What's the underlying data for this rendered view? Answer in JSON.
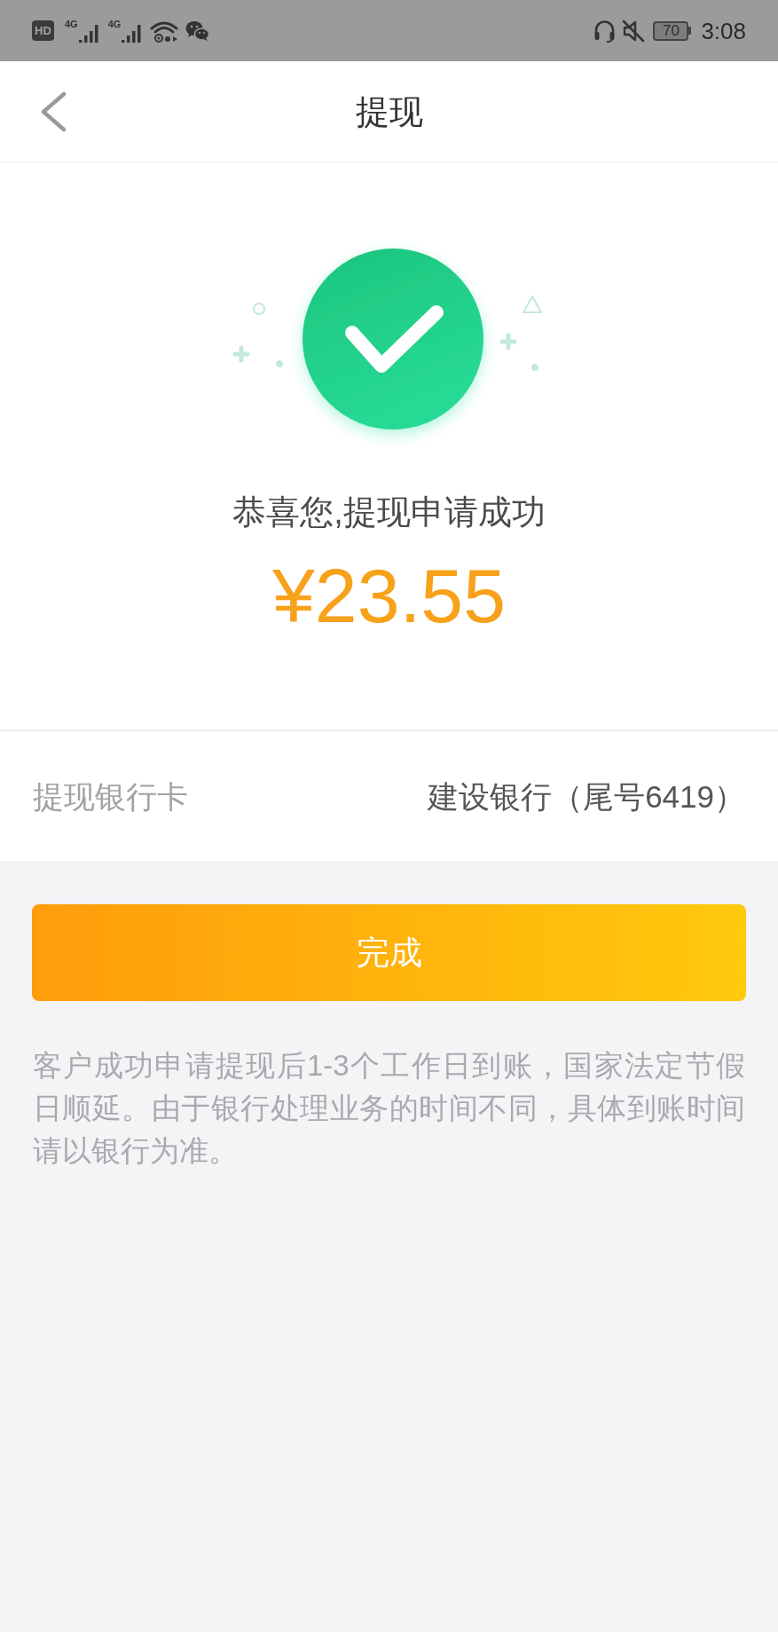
{
  "status_bar": {
    "badge": "HD",
    "networks": [
      {
        "label": "4G"
      },
      {
        "label": "4G"
      }
    ],
    "battery": "70",
    "time": "3:08"
  },
  "nav": {
    "title": "提现"
  },
  "result": {
    "message": "恭喜您,提现申请成功",
    "amount": "¥23.55"
  },
  "bank_card": {
    "label": "提现银行卡",
    "value": "建设银行（尾号6419）"
  },
  "button": {
    "label": "完成"
  },
  "note": "客户成功申请提现后1-3个工作日到账，国家法定节假日顺延。由于银行处理业务的时间不同，具体到账时间请以银行为准。"
}
